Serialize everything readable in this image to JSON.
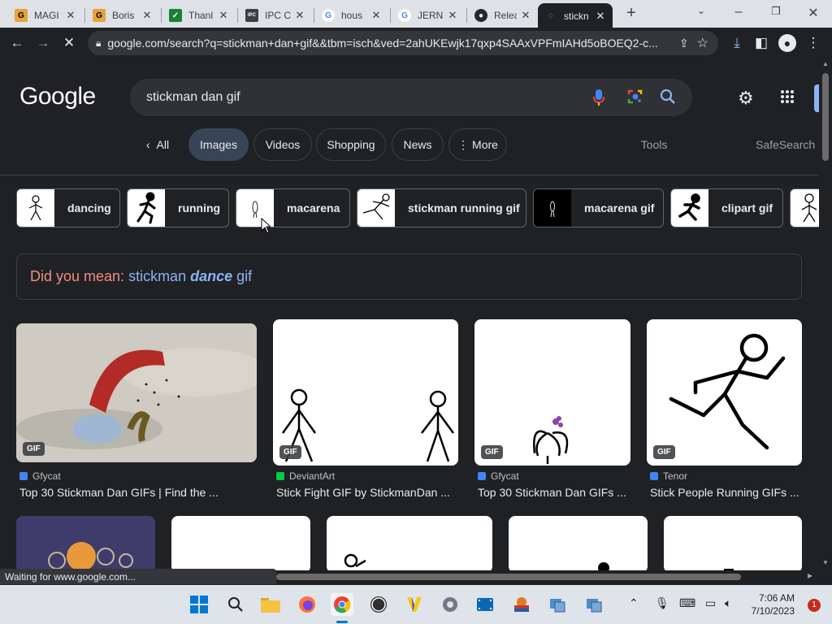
{
  "tabs": [
    {
      "title": "MAGI",
      "favicon": "G",
      "color": "#e8a33d"
    },
    {
      "title": "Boris",
      "favicon": "G",
      "color": "#e8a33d"
    },
    {
      "title": "Thanl",
      "favicon": "✓",
      "color": "#188038"
    },
    {
      "title": "IPC C",
      "favicon": "IPC",
      "color": "#3c4043"
    },
    {
      "title": "hous",
      "favicon": "G",
      "color": "#4285f4"
    },
    {
      "title": "JERN",
      "favicon": "G",
      "color": "#4285f4"
    },
    {
      "title": "Relea",
      "favicon": "●",
      "color": "#24292f"
    },
    {
      "title": "stickn",
      "favicon": "◌",
      "color": "#8ab4f8"
    }
  ],
  "address": {
    "url": "google.com/search?q=stickman+dan+gif&&tbm=isch&ved=2ahUKEwjk17qxp4SAAxVPFmIAHd5oBOEQ2-c..."
  },
  "google": {
    "logo": "Google"
  },
  "search": {
    "query": "stickman dan gif"
  },
  "search_tabs": {
    "all": "All",
    "images": "Images",
    "videos": "Videos",
    "shopping": "Shopping",
    "news": "News",
    "more": "More",
    "tools": "Tools",
    "safesearch": "SafeSearch"
  },
  "chips": [
    {
      "label": "dancing"
    },
    {
      "label": "running"
    },
    {
      "label": "macarena"
    },
    {
      "label": "stickman running gif"
    },
    {
      "label": "macarena gif"
    },
    {
      "label": "clipart gif"
    }
  ],
  "did_you_mean": {
    "prefix": "Did you mean:",
    "part1": "stickman",
    "part2": "dance",
    "part3": "gif"
  },
  "results": [
    {
      "badge": "GIF",
      "source": "Gfycat",
      "title": "Top 30 Stickman Dan GIFs | Find the ...",
      "source_color": "#4285f4"
    },
    {
      "badge": "GIF",
      "source": "DeviantArt",
      "title": "Stick Fight GIF by StickmanDan ...",
      "source_color": "#05cc47"
    },
    {
      "badge": "GIF",
      "source": "Gfycat",
      "title": "Top 30 Stickman Dan GIFs ...",
      "source_color": "#4285f4"
    },
    {
      "badge": "GIF",
      "source": "Tenor",
      "title": "Stick People Running GIFs ...",
      "source_color": "#4285f4"
    }
  ],
  "status": {
    "text": "Waiting for www.google.com..."
  },
  "clock": {
    "time": "7:06 AM",
    "date": "7/10/2023"
  },
  "notifications": {
    "count": "1"
  }
}
